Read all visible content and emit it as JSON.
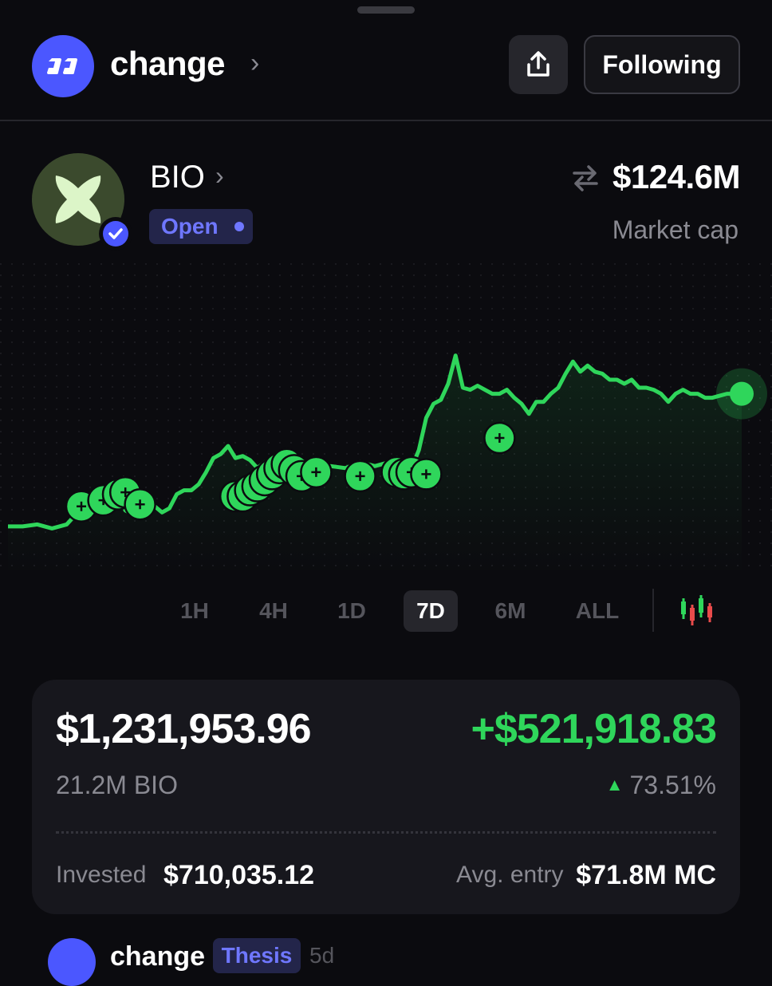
{
  "header": {
    "brand": "change",
    "follow_label": "Following",
    "icons": {
      "logo": "change-logo-icon",
      "chevron": "chevron-right-icon",
      "share": "share-icon"
    }
  },
  "token": {
    "symbol": "BIO",
    "status": "Open",
    "market_cap": "$124.6M",
    "market_cap_label": "Market cap",
    "verified": true,
    "icons": {
      "swap": "swap-arrows-icon",
      "verified": "verified-check-icon"
    }
  },
  "chart_data": {
    "type": "line",
    "title": "",
    "xlabel": "",
    "ylabel": "",
    "x_range": "7D",
    "grid": true,
    "line_color": "#2fd65b",
    "ylim": [
      0,
      100
    ],
    "x": [
      0,
      2,
      4,
      6,
      8,
      9,
      10,
      11,
      12,
      13,
      14,
      15,
      16,
      17,
      18,
      19,
      20,
      21,
      22,
      23,
      24,
      25,
      26,
      27,
      28,
      29,
      30,
      31,
      32,
      33,
      34,
      35,
      36,
      37,
      38,
      39,
      40,
      42,
      44,
      46,
      48,
      50,
      52,
      53,
      54,
      55,
      56,
      57,
      58,
      59,
      60,
      61,
      62,
      63,
      64,
      65,
      66,
      67,
      68,
      69,
      70,
      71,
      72,
      73,
      74,
      75,
      76,
      77,
      78,
      79,
      80,
      81,
      82,
      83,
      84,
      85,
      86,
      87,
      88,
      89,
      90,
      91,
      92,
      93,
      94,
      95,
      96,
      97,
      98,
      99,
      100
    ],
    "values": [
      4,
      4,
      5,
      3,
      5,
      9,
      12,
      14,
      17,
      20,
      23,
      21,
      12,
      10,
      12,
      11,
      14,
      11,
      13,
      20,
      22,
      22,
      25,
      31,
      38,
      40,
      44,
      38,
      39,
      37,
      33,
      36,
      36,
      34,
      31,
      34,
      37,
      33,
      34,
      33,
      36,
      34,
      36,
      38,
      30,
      33,
      42,
      58,
      65,
      67,
      75,
      89,
      73,
      72,
      74,
      72,
      70,
      70,
      72,
      68,
      65,
      60,
      66,
      66,
      70,
      73,
      80,
      86,
      81,
      84,
      81,
      80,
      77,
      77,
      75,
      77,
      73,
      73,
      72,
      70,
      66,
      70,
      72,
      70,
      70,
      68,
      68,
      69,
      70,
      70,
      70
    ],
    "buy_markers_x": [
      10,
      13,
      15,
      16,
      18,
      31,
      32,
      33,
      34,
      35,
      36,
      37,
      38,
      39,
      40,
      42,
      48,
      53,
      54,
      55,
      57,
      67
    ],
    "buy_markers_y": [
      14,
      17,
      20,
      21,
      15,
      19,
      19,
      22,
      24,
      27,
      30,
      33,
      35,
      32,
      29,
      31,
      29,
      31,
      30,
      31,
      30,
      48
    ]
  },
  "timeframes": [
    "1H",
    "4H",
    "1D",
    "7D",
    "6M",
    "ALL"
  ],
  "active_timeframe": "7D",
  "position": {
    "value": "$1,231,953.96",
    "pnl": "+$521,918.83",
    "quantity": "21.2M BIO",
    "pnl_pct": "73.51%",
    "invested_label": "Invested",
    "invested_value": "$710,035.12",
    "avg_entry_label": "Avg. entry",
    "avg_entry_value": "$71.8M MC"
  },
  "feed_peek": {
    "name": "change",
    "badge": "Thesis",
    "time": "5d"
  },
  "colors": {
    "background": "#0b0b0f",
    "accent": "#4b57ff",
    "positive": "#2fd65b",
    "card": "#17171d"
  }
}
